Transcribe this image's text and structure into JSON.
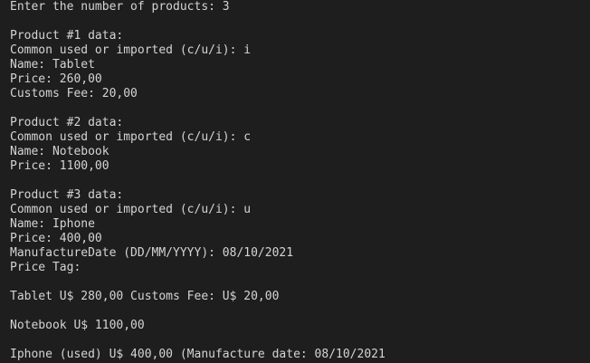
{
  "terminal": {
    "lines": [
      "Enter the number of products: 3",
      "",
      "Product #1 data:",
      "Common used or imported (c/u/i): i",
      "Name: Tablet",
      "Price: 260,00",
      "Customs Fee: 20,00",
      "",
      "Product #2 data:",
      "Common used or imported (c/u/i): c",
      "Name: Notebook",
      "Price: 1100,00",
      "",
      "Product #3 data:",
      "Common used or imported (c/u/i): u",
      "Name: Iphone",
      "Price: 400,00",
      "ManufactureDate (DD/MM/YYYY): 08/10/2021",
      "Price Tag:",
      "",
      "Tablet U$ 280,00 Customs Fee: U$ 20,00",
      "",
      "Notebook U$ 1100,00",
      "",
      "Iphone (used) U$ 400,00 (Manufacture date: 08/10/2021"
    ]
  }
}
